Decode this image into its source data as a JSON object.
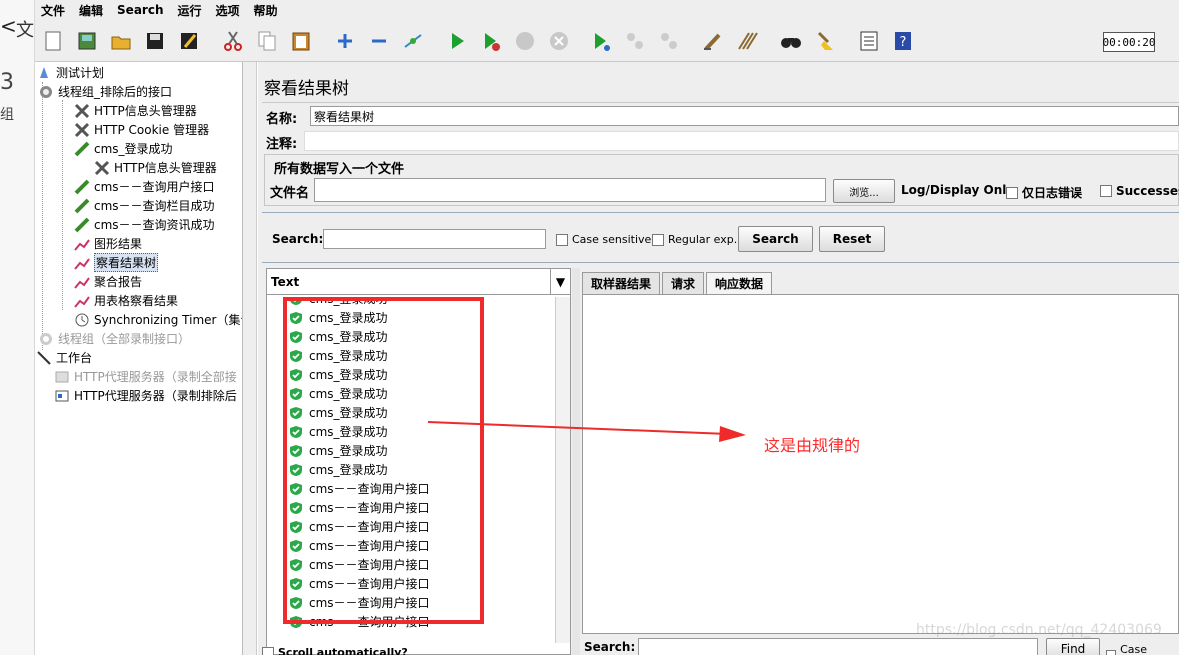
{
  "background_app": {
    "glyph_chevron": "<",
    "glyph_wen": "文",
    "glyph_three": "3",
    "glyph_zu": "组"
  },
  "menu": [
    "文件",
    "编辑",
    "Search",
    "运行",
    "选项",
    "帮助"
  ],
  "toolbar": {
    "icons": [
      "new-icon",
      "templates-icon",
      "open-icon",
      "save-icon",
      "save-as-icon",
      "cut-icon",
      "copy-icon",
      "paste-icon",
      "expand-icon",
      "collapse-icon",
      "toggle-icon",
      "start-icon",
      "start-no-pause-icon",
      "stop-icon",
      "shutdown-icon",
      "remote-start-icon",
      "remote-stop-icon",
      "remote-exit-icon",
      "clear-icon",
      "clear-all-icon",
      "search-icon",
      "reset-search-icon",
      "function-helper-icon",
      "help-icon"
    ],
    "timer": "00:00:20"
  },
  "tree": [
    {
      "label": "测试计划",
      "icon": "test-plan-icon"
    },
    {
      "label": "线程组_排除后的接口",
      "icon": "thread-group-icon"
    },
    {
      "label": "HTTP信息头管理器",
      "icon": "header-manager-icon"
    },
    {
      "label": "HTTP Cookie 管理器",
      "icon": "cookie-manager-icon"
    },
    {
      "label": "cms_登录成功",
      "icon": "sampler-icon"
    },
    {
      "label": "HTTP信息头管理器",
      "icon": "header-manager-icon"
    },
    {
      "label": "cms－－查询用户接口",
      "icon": "sampler-icon"
    },
    {
      "label": "cms－－查询栏目成功",
      "icon": "sampler-icon"
    },
    {
      "label": "cms－－查询资讯成功",
      "icon": "sampler-icon"
    },
    {
      "label": "图形结果",
      "icon": "graph-results-icon"
    },
    {
      "label": "察看结果树",
      "icon": "view-results-tree-icon"
    },
    {
      "label": "聚合报告",
      "icon": "aggregate-report-icon"
    },
    {
      "label": "用表格察看结果",
      "icon": "table-results-icon"
    },
    {
      "label": "Synchronizing Timer（集合",
      "icon": "timer-icon"
    },
    {
      "label": "线程组（全部录制接口）",
      "icon": "thread-group-icon"
    },
    {
      "label": "工作台",
      "icon": "workbench-icon"
    },
    {
      "label": "HTTP代理服务器（录制全部接",
      "icon": "proxy-server-icon"
    },
    {
      "label": "HTTP代理服务器（录制排除后",
      "icon": "proxy-server-icon"
    }
  ],
  "main": {
    "title": "察看结果树",
    "name_label": "名称:",
    "name_value": "察看结果树",
    "comment_label": "注释:",
    "comment_value": "",
    "group_title": "所有数据写入一个文件",
    "filename_label": "文件名",
    "filename_value": "",
    "browse_label": "浏览...",
    "log_display_label": "Log/Display Only:",
    "errors_only_label": "仅日志错误",
    "successes_label": "Successes",
    "search_label": "Search:",
    "search_value": "",
    "case_sensitive_label": "Case sensitive",
    "regex_label": "Regular exp.",
    "search_button": "Search",
    "reset_button": "Reset",
    "renderer_combo": "Text",
    "results": [
      "cms_登录成功",
      "cms_登录成功",
      "cms_登录成功",
      "cms_登录成功",
      "cms_登录成功",
      "cms_登录成功",
      "cms_登录成功",
      "cms_登录成功",
      "cms_登录成功",
      "cms_登录成功",
      "cms－－查询用户接口",
      "cms－－查询用户接口",
      "cms－－查询用户接口",
      "cms－－查询用户接口",
      "cms－－查询用户接口",
      "cms－－查询用户接口",
      "cms－－查询用户接口",
      "cms－－查询用户接口"
    ],
    "scroll_auto_label": "Scroll automatically?",
    "tabs": [
      "取样器结果",
      "请求",
      "响应数据"
    ],
    "active_tab": "响应数据",
    "bottom_search_label": "Search:",
    "find_button": "Find",
    "bottom_case_label": "Case sensitiv",
    "watermark": "https://blog.csdn.net/qq_42403069"
  },
  "annotation": {
    "text": "这是由规律的",
    "color": "#ff2b2b"
  },
  "colors": {
    "highlight_box": "#ee2a2a",
    "selection": "#d8e4f4",
    "success_check": "#2aa84a"
  }
}
